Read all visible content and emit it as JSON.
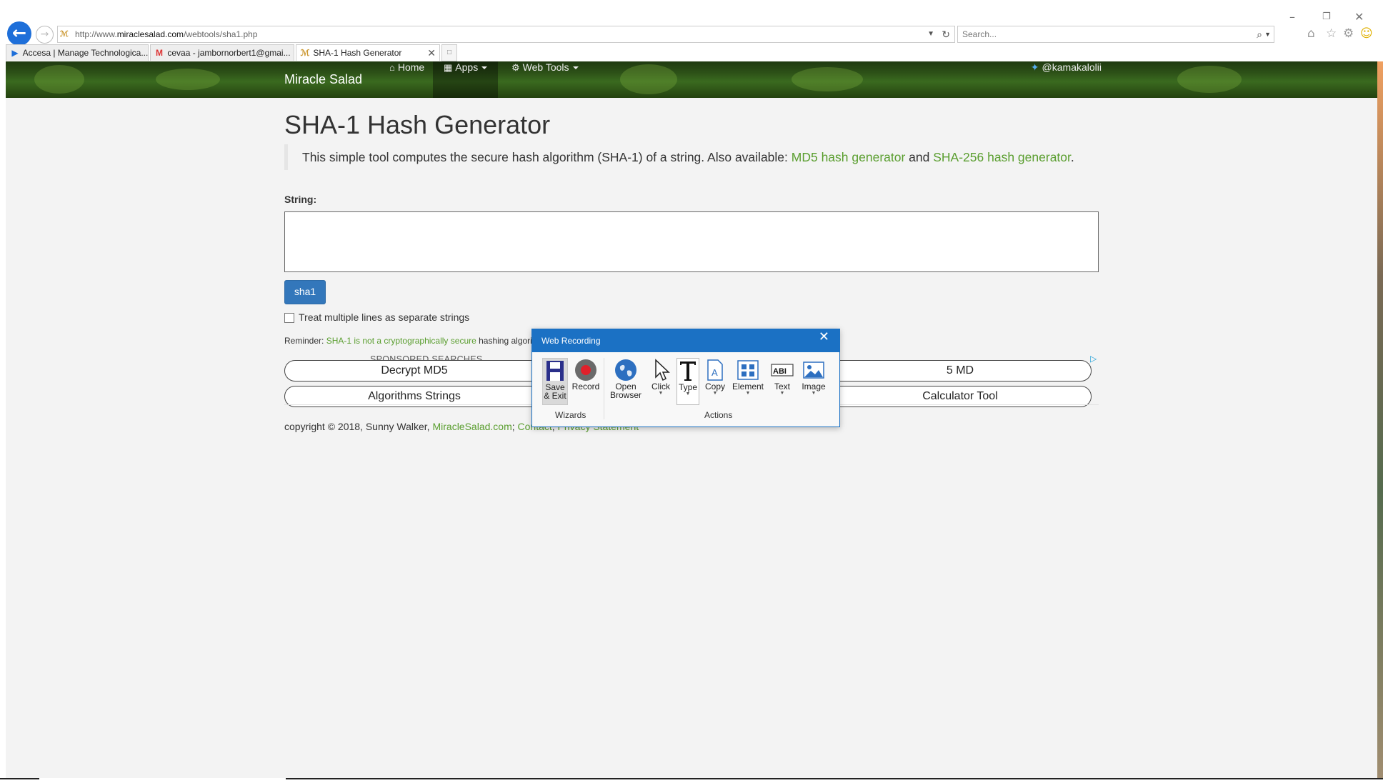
{
  "browser": {
    "url_prefix": "http://www.",
    "url_domain": "miraclesalad.com",
    "url_path": "/webtools/sha1.php",
    "search_placeholder": "Search...",
    "tabs": [
      {
        "label": "Accesa | Manage Technologica...",
        "icon": "play-icon"
      },
      {
        "label": "cevaa - jambornorbert1@gmai...",
        "icon": "gmail-icon"
      },
      {
        "label": "SHA-1 Hash Generator",
        "icon": "miraclesalad-favicon",
        "active": true
      }
    ]
  },
  "nav": {
    "brand": "Miracle Salad",
    "home": "Home",
    "apps": "Apps",
    "webtools": "Web Tools",
    "twitter": "@kamakalolii"
  },
  "page": {
    "title": "SHA-1 Hash Generator",
    "intro": "This simple tool computes the secure hash algorithm (SHA-1) of a string. Also available: ",
    "link_md5": "MD5 hash generator",
    "and": " and ",
    "link_sha256": "SHA-256 hash generator",
    "period": ".",
    "string_label": "String:",
    "button_label": "sha1",
    "checkbox_label": "Treat multiple lines as separate strings",
    "reminder_prefix": "Reminder: ",
    "reminder_link": "SHA-1 is not a cryptographically secure",
    "reminder_suffix": " hashing algorit",
    "sponsored": "SPONSORED SEARCHES",
    "ads": [
      "Decrypt MD5",
      "Algorithms Strings",
      "5 MD",
      "Calculator Tool"
    ],
    "footer_prefix": "copyright © 2018, Sunny Walker, ",
    "footer_site": "MiracleSalad.com",
    "footer_contact": "Contact",
    "footer_privacy": "Privacy Statement",
    "sep": "; "
  },
  "recorder": {
    "title": "Web Recording",
    "tools": {
      "save_1": "Save",
      "save_2": "& Exit",
      "record": "Record",
      "open_1": "Open",
      "open_2": "Browser",
      "click": "Click",
      "type": "Type",
      "copy": "Copy",
      "element": "Element",
      "text": "Text",
      "image": "Image"
    },
    "group_wizards": "Wizards",
    "group_actions": "Actions"
  },
  "colors": {
    "link": "#5a9e2f",
    "button": "#3377bb",
    "recorder_accent": "#1b71c4"
  }
}
